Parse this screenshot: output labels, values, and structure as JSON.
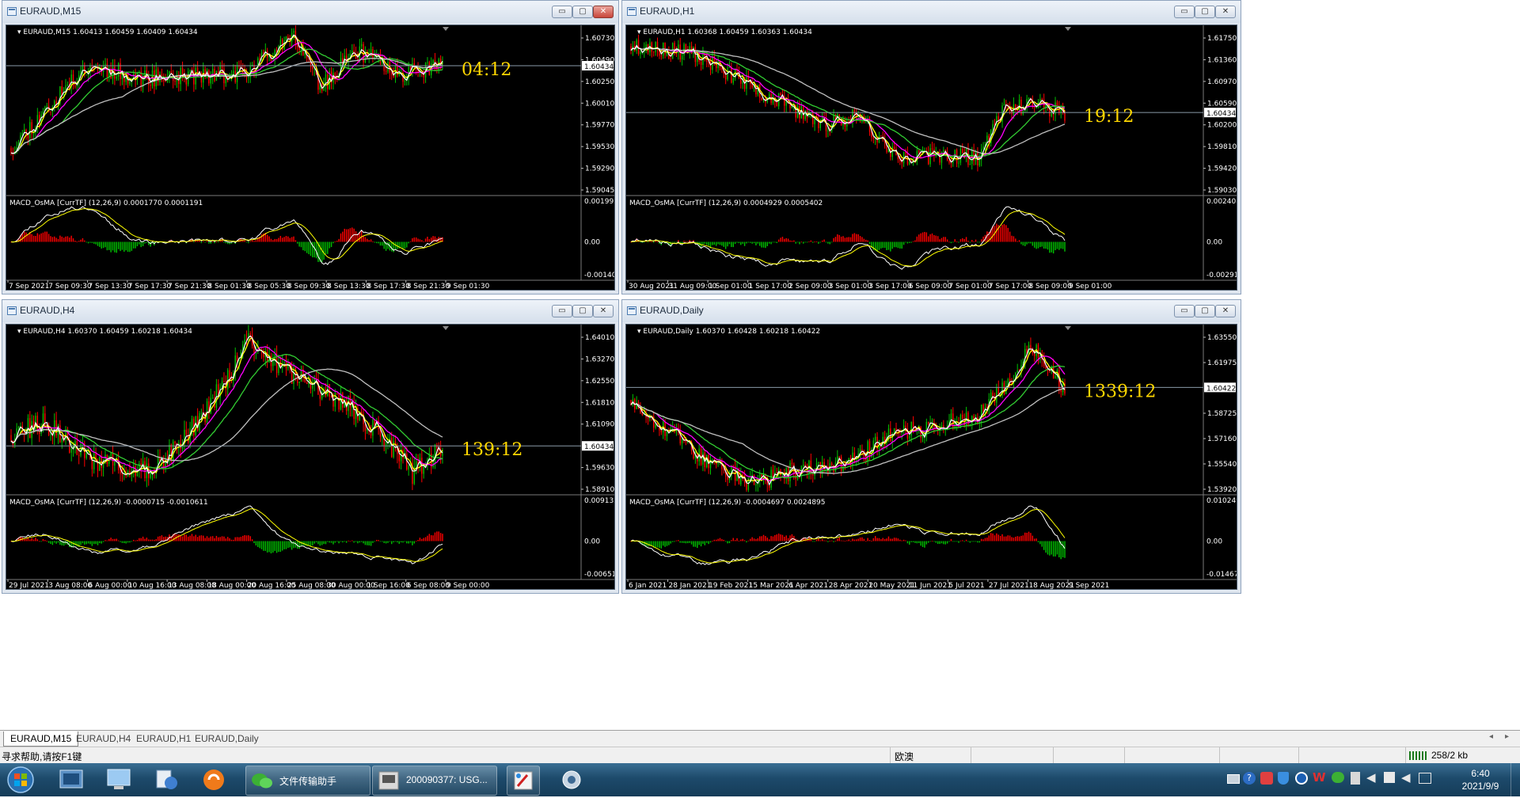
{
  "windows": [
    {
      "key": "m15",
      "title": "EURAUD,M15",
      "header": "EURAUD,M15  1.60413 1.60459 1.60409 1.60434",
      "macd_header": "MACD_OsMA [CurrTF] (12,26,9) 0.0001770 0.0001191",
      "price_ticks": [
        "1.60730",
        "1.60490",
        "1.60250",
        "1.60010",
        "1.59770",
        "1.59530",
        "1.59290",
        "1.59045"
      ],
      "current_price": "1.60434",
      "macd_ticks": [
        "0.0019924",
        "0.00",
        "-0.001404"
      ],
      "time_ticks": [
        "7 Sep 2021",
        "7 Sep 09:30",
        "7 Sep 13:30",
        "7 Sep 17:30",
        "7 Sep 21:30",
        "8 Sep 01:30",
        "8 Sep 05:30",
        "8 Sep 09:30",
        "8 Sep 13:30",
        "8 Sep 17:30",
        "8 Sep 21:30",
        "9 Sep 01:30"
      ],
      "timer": "04:12",
      "close_active": true,
      "series": {
        "pmin": 1.5905,
        "pmax": 1.6085,
        "seed": 11,
        "start": 1.5955,
        "trend": [
          [
            0,
            1.5955
          ],
          [
            0.18,
            1.6045
          ],
          [
            0.3,
            1.603
          ],
          [
            0.55,
            1.6035
          ],
          [
            0.65,
            1.608
          ],
          [
            0.72,
            1.602
          ],
          [
            0.8,
            1.606
          ],
          [
            0.9,
            1.6035
          ],
          [
            1.0,
            1.6043
          ]
        ],
        "vol": 0.0009
      }
    },
    {
      "key": "h1",
      "title": "EURAUD,H1",
      "header": "EURAUD,H1  1.60368 1.60459 1.60363 1.60434",
      "macd_header": "MACD_OsMA [CurrTF] (12,26,9) 0.0004929 0.0005402",
      "price_ticks": [
        "1.61750",
        "1.61360",
        "1.60970",
        "1.60590",
        "1.60200",
        "1.59810",
        "1.59420",
        "1.59030"
      ],
      "current_price": "1.60434",
      "macd_ticks": [
        "0.0024085",
        "0.00",
        "-0.002913"
      ],
      "time_ticks": [
        "30 Aug 2021",
        "31 Aug 09:00",
        "1 Sep 01:00",
        "1 Sep 17:00",
        "2 Sep 09:00",
        "3 Sep 01:00",
        "3 Sep 17:00",
        "6 Sep 09:00",
        "7 Sep 01:00",
        "7 Sep 17:00",
        "8 Sep 09:00",
        "9 Sep 01:00"
      ],
      "timer": "19:12",
      "close_active": false,
      "series": {
        "pmin": 1.5893,
        "pmax": 1.62,
        "seed": 23,
        "start": 1.6165,
        "trend": [
          [
            0,
            1.6165
          ],
          [
            0.15,
            1.615
          ],
          [
            0.3,
            1.608
          ],
          [
            0.45,
            1.602
          ],
          [
            0.52,
            1.604
          ],
          [
            0.62,
            1.596
          ],
          [
            0.75,
            1.5965
          ],
          [
            0.8,
            1.596
          ],
          [
            0.86,
            1.605
          ],
          [
            0.93,
            1.606
          ],
          [
            1.0,
            1.6043
          ]
        ],
        "vol": 0.0014
      }
    },
    {
      "key": "h4",
      "title": "EURAUD,H4",
      "header": "EURAUD,H4  1.60370 1.60459 1.60218 1.60434",
      "macd_header": "MACD_OsMA [CurrTF] (12,26,9) -0.0000715 -0.0010611",
      "price_ticks": [
        "1.64010",
        "1.63270",
        "1.62550",
        "1.61810",
        "1.61090",
        "1.60434",
        "1.59630",
        "1.58910"
      ],
      "current_price": "1.60434",
      "macd_ticks": [
        "0.0091321",
        "0.00",
        "-0.006510"
      ],
      "time_ticks": [
        "29 Jul 2021",
        "3 Aug 08:00",
        "6 Aug 00:00",
        "10 Aug 16:00",
        "13 Aug 08:00",
        "18 Aug 00:00",
        "20 Aug 16:00",
        "25 Aug 08:00",
        "30 Aug 00:00",
        "1 Sep 16:00",
        "6 Sep 08:00",
        "9 Sep 00:00"
      ],
      "timer": "139:12",
      "close_active": false,
      "series": {
        "pmin": 1.588,
        "pmax": 1.645,
        "seed": 37,
        "start": 1.608,
        "trend": [
          [
            0,
            1.608
          ],
          [
            0.08,
            1.612
          ],
          [
            0.18,
            1.6
          ],
          [
            0.32,
            1.595
          ],
          [
            0.45,
            1.615
          ],
          [
            0.55,
            1.64
          ],
          [
            0.63,
            1.63
          ],
          [
            0.7,
            1.625
          ],
          [
            0.78,
            1.618
          ],
          [
            0.86,
            1.608
          ],
          [
            0.93,
            1.595
          ],
          [
            1.0,
            1.6043
          ]
        ],
        "vol": 0.0035
      }
    },
    {
      "key": "daily",
      "title": "EURAUD,Daily",
      "header": "EURAUD,Daily  1.60370 1.60428 1.60218 1.60422",
      "macd_header": "MACD_OsMA [CurrTF] (12,26,9) -0.0004697 0.0024895",
      "price_ticks": [
        "1.63550",
        "1.61975",
        "1.60422",
        "1.58725",
        "1.57160",
        "1.55540",
        "1.53920"
      ],
      "current_price": "1.60422",
      "macd_ticks": [
        "0.0102498",
        "0.00",
        "-0.014677"
      ],
      "time_ticks": [
        "6 Jan 2021",
        "28 Jan 2021",
        "19 Feb 2021",
        "15 Mar 2021",
        "6 Apr 2021",
        "28 Apr 2021",
        "20 May 2021",
        "11 Jun 2021",
        "5 Jul 2021",
        "27 Jul 2021",
        "18 Aug 2021",
        "9 Sep 2021"
      ],
      "timer": "1339:12",
      "close_active": false,
      "series": {
        "pmin": 1.528,
        "pmax": 1.648,
        "seed": 53,
        "start": 1.595,
        "trend": [
          [
            0,
            1.595
          ],
          [
            0.1,
            1.57
          ],
          [
            0.18,
            1.55
          ],
          [
            0.28,
            1.535
          ],
          [
            0.38,
            1.545
          ],
          [
            0.5,
            1.55
          ],
          [
            0.6,
            1.57
          ],
          [
            0.72,
            1.578
          ],
          [
            0.8,
            1.585
          ],
          [
            0.88,
            1.61
          ],
          [
            0.92,
            1.635
          ],
          [
            0.97,
            1.615
          ],
          [
            1.0,
            1.6042
          ]
        ],
        "vol": 0.006
      }
    }
  ],
  "tabs": [
    "EURAUD,M15",
    "EURAUD,H4",
    "EURAUD,H1",
    "EURAUD,Daily"
  ],
  "status": {
    "help": "寻求帮助,请按F1键",
    "profile": "欧澳",
    "traffic": "258/2 kb"
  },
  "taskbar": {
    "apps": [
      {
        "name": "start-orb",
        "label": ""
      },
      {
        "name": "app-icon-1",
        "label": ""
      },
      {
        "name": "app-icon-2",
        "label": ""
      },
      {
        "name": "app-icon-3",
        "label": ""
      },
      {
        "name": "app-icon-4",
        "label": ""
      }
    ],
    "wechat_label": "文件传输助手",
    "task_label": "200090377: USG...",
    "clock_time": "6:40",
    "clock_date": "2021/9/9"
  },
  "colors": {
    "bull": "#00c000",
    "bear": "#ff0000",
    "ma_yellow": "#ffff00",
    "ma_magenta": "#ff00ff",
    "ma_green": "#32cd32",
    "ma_silver": "#c0c0c0",
    "timer": "#ffd700",
    "grid_label": "#ffffff"
  }
}
